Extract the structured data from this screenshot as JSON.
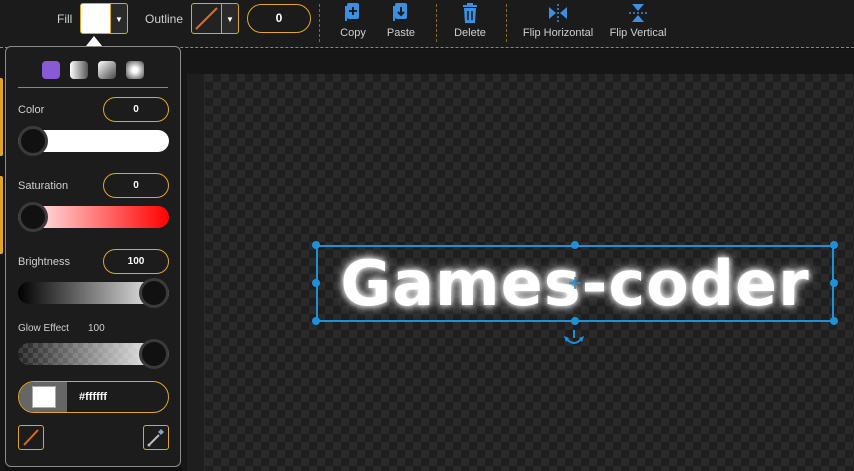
{
  "toolbar": {
    "fill_label": "Fill",
    "fill_color": "#ffffff",
    "outline_label": "Outline",
    "outline_width": "0",
    "buttons": [
      {
        "label": "Copy",
        "icon": "copy-icon"
      },
      {
        "label": "Paste",
        "icon": "paste-icon"
      },
      {
        "label": "Delete",
        "icon": "trash-icon"
      },
      {
        "label": "Flip Horizontal",
        "icon": "flip-horizontal-icon"
      },
      {
        "label": "Flip Vertical",
        "icon": "flip-vertical-icon"
      }
    ]
  },
  "panel": {
    "fill_modes": [
      "solid",
      "linear-gradient",
      "linear-gradient-2",
      "radial-gradient"
    ],
    "color_label": "Color",
    "color_value": "0",
    "color_level": 0,
    "saturation_label": "Saturation",
    "saturation_value": "0",
    "saturation_level": 0,
    "brightness_label": "Brightness",
    "brightness_value": "100",
    "brightness_level": 100,
    "glow_label": "Glow Effect",
    "glow_value": "100",
    "glow_level": 100,
    "hex_value": "#ffffff",
    "no_color_icon": "no-color-icon",
    "eyedropper_icon": "eyedropper-icon"
  },
  "canvas": {
    "text": "Games-coder"
  },
  "colors": {
    "accent": "#e0a62a",
    "selection": "#1e90d8",
    "purple_swatch": "#8a5ad6"
  }
}
